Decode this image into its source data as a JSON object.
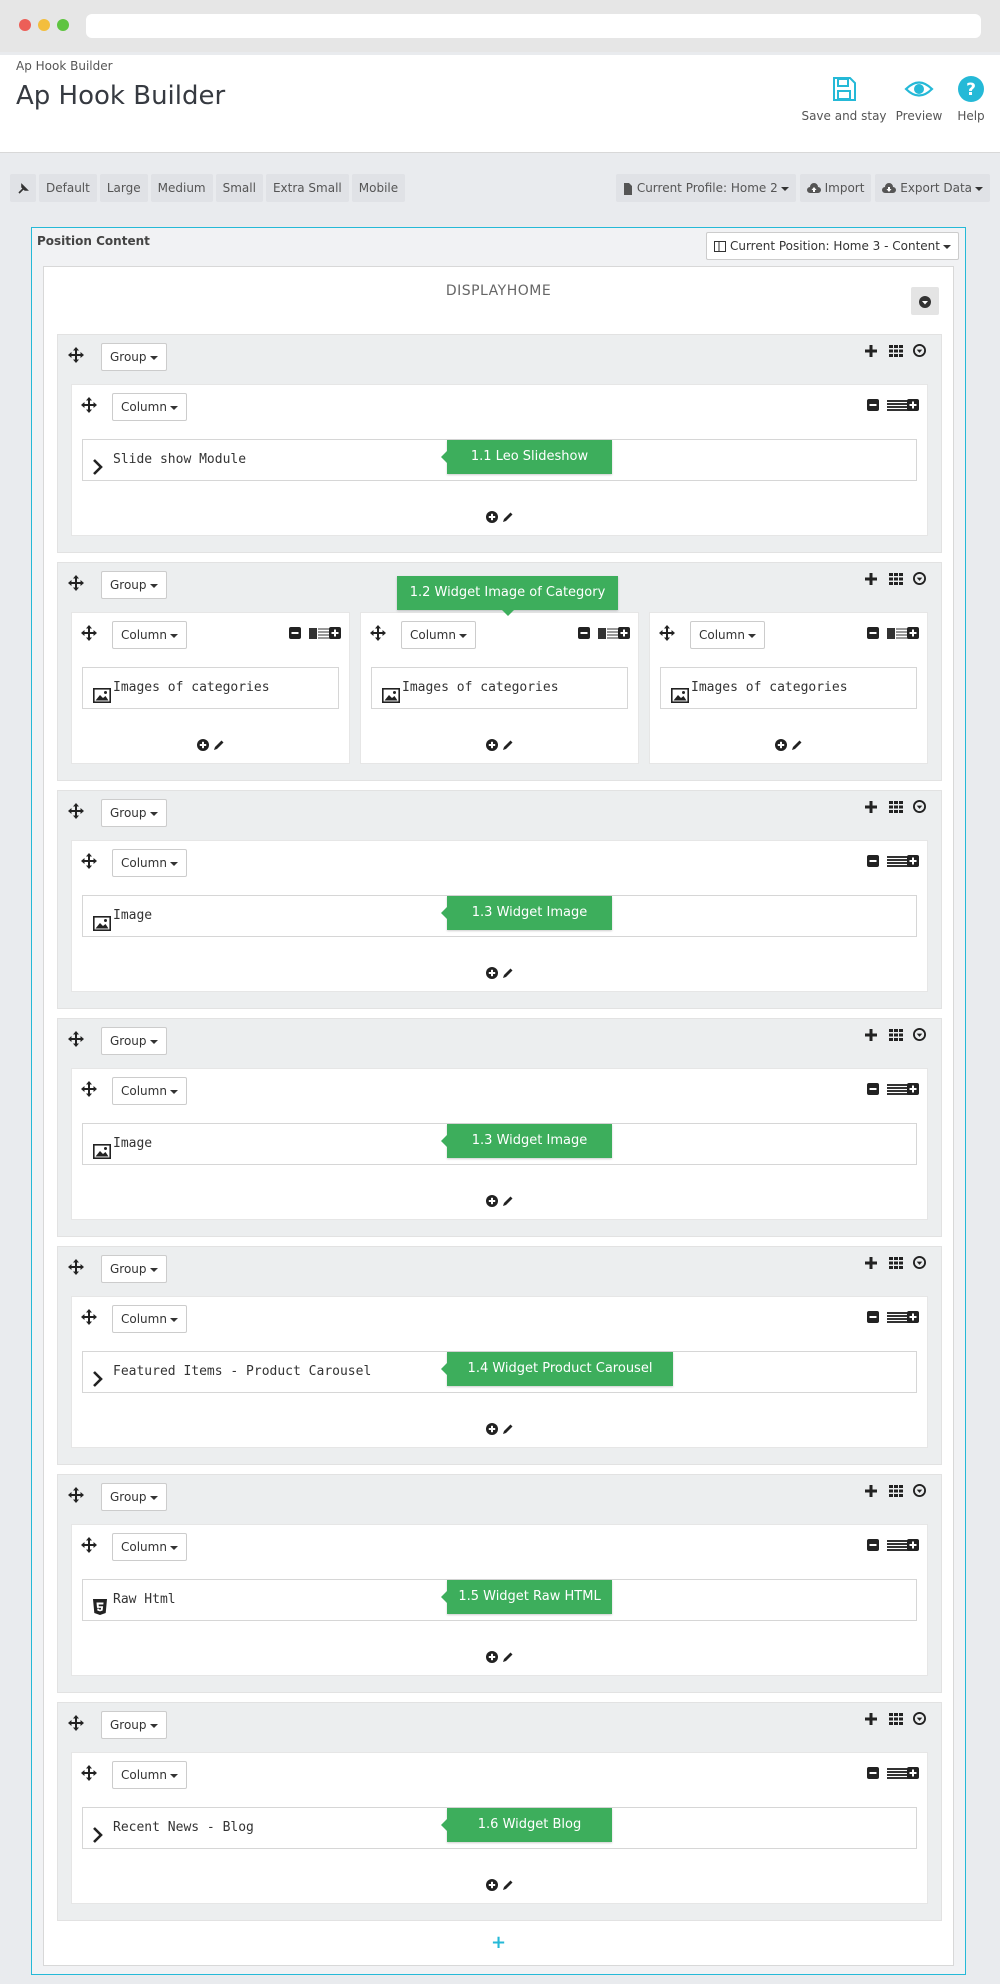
{
  "header": {
    "breadcrumb": "Ap Hook Builder",
    "title": "Ap Hook Builder",
    "toolbar": {
      "save_label": "Save and stay",
      "preview_label": "Preview",
      "help_label": "Help"
    }
  },
  "devices": [
    "Default",
    "Large",
    "Medium",
    "Small",
    "Extra Small",
    "Mobile"
  ],
  "profile": {
    "current_label": "Current Profile: Home 2",
    "import_label": "Import",
    "export_label": "Export Data"
  },
  "position": {
    "label": "Position Content",
    "current_label": "Current Position: Home 3 - Content",
    "hook_title": "DISPLAYHOME",
    "add_group": "+"
  },
  "labels": {
    "group": "Group",
    "column": "Column"
  },
  "groups": [
    {
      "columns": [
        {
          "widget": "Slide show Module",
          "icon": "chevron-icon"
        }
      ],
      "callout": "1.1 Leo Slideshow"
    },
    {
      "columns": [
        {
          "widget": "Images of categories",
          "icon": "image-icon"
        },
        {
          "widget": "Images of categories",
          "icon": "image-icon"
        },
        {
          "widget": "Images of categories",
          "icon": "image-icon"
        }
      ],
      "callout": "1.2 Widget Image of Category"
    },
    {
      "columns": [
        {
          "widget": "Image",
          "icon": "image-icon"
        }
      ],
      "callout": "1.3 Widget Image"
    },
    {
      "columns": [
        {
          "widget": "Image",
          "icon": "image-icon"
        }
      ],
      "callout": "1.3 Widget Image"
    },
    {
      "columns": [
        {
          "widget": "Featured Items - Product Carousel",
          "icon": "chevron-icon"
        }
      ],
      "callout": "1.4 Widget Product Carousel"
    },
    {
      "columns": [
        {
          "widget": "Raw Html",
          "icon": "html5-icon"
        }
      ],
      "callout": "1.5 Widget Raw HTML"
    },
    {
      "columns": [
        {
          "widget": "Recent News - Blog",
          "icon": "chevron-icon"
        }
      ],
      "callout": "1.6 Widget Blog"
    }
  ],
  "colors": {
    "accent": "#25b9d7",
    "callout": "#3dae5c"
  }
}
